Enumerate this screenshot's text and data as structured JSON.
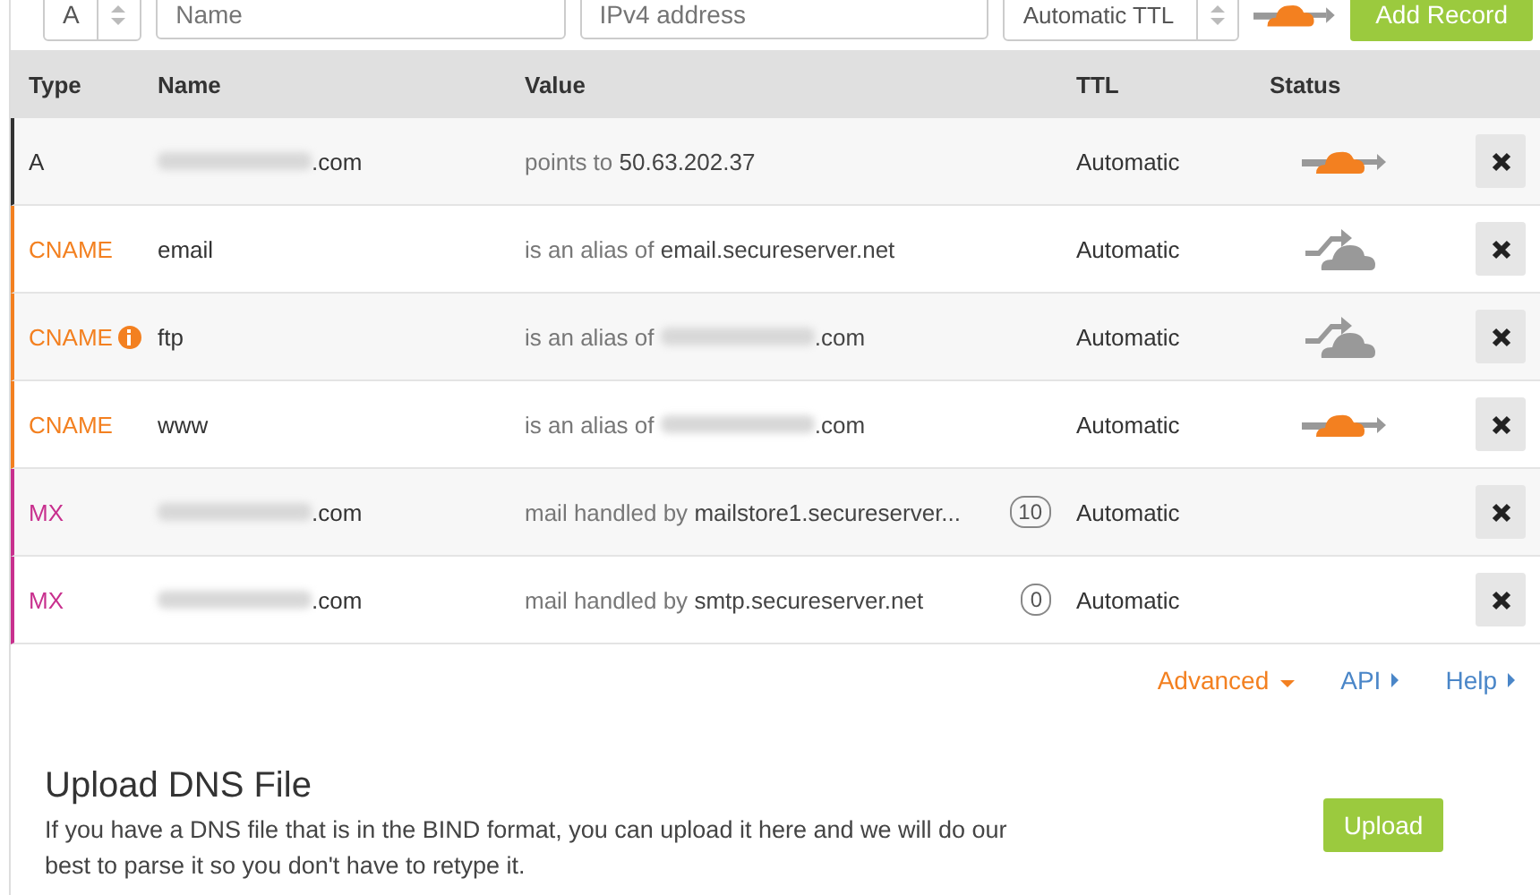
{
  "form": {
    "type_value": "A",
    "name_placeholder": "Name",
    "value_placeholder": "IPv4 address",
    "ttl_value": "Automatic TTL",
    "proxied": true,
    "add_button": "Add Record"
  },
  "table": {
    "columns": [
      "Type",
      "Name",
      "Value",
      "TTL",
      "Status"
    ],
    "rows": [
      {
        "type": "A",
        "color": "#333333",
        "info": false,
        "name": ".com",
        "name_redacted": true,
        "value_prefix": "points to",
        "value_target": "50.63.202.37",
        "value_redacted": false,
        "ttl": "Automatic",
        "kind": "proxied"
      },
      {
        "type": "CNAME",
        "color": "#f38020",
        "info": false,
        "name": "email",
        "name_redacted": false,
        "value_prefix": "is an alias of",
        "value_target": "email.secureserver.net",
        "value_redacted": false,
        "ttl": "Automatic",
        "kind": "dns_only"
      },
      {
        "type": "CNAME",
        "color": "#f38020",
        "info": true,
        "name": "ftp",
        "name_redacted": false,
        "value_prefix": "is an alias of",
        "value_target": ".com",
        "value_redacted": true,
        "ttl": "Automatic",
        "kind": "dns_only"
      },
      {
        "type": "CNAME",
        "color": "#f38020",
        "info": false,
        "name": "www",
        "name_redacted": false,
        "value_prefix": "is an alias of",
        "value_target": ".com",
        "value_redacted": true,
        "ttl": "Automatic",
        "kind": "proxied"
      },
      {
        "type": "MX",
        "color": "#c8308e",
        "info": false,
        "name": ".com",
        "name_redacted": true,
        "value_prefix": "mail handled by",
        "value_target": "mailstore1.secureserver...",
        "value_redacted": false,
        "priority": "10",
        "ttl": "Automatic",
        "kind": "none"
      },
      {
        "type": "MX",
        "color": "#c8308e",
        "info": false,
        "name": ".com",
        "name_redacted": true,
        "value_prefix": "mail handled by",
        "value_target": "smtp.secureserver.net",
        "value_redacted": false,
        "priority": "0",
        "ttl": "Automatic",
        "kind": "none"
      }
    ]
  },
  "links": [
    {
      "label": "Advanced",
      "kind": "dropdown"
    },
    {
      "label": "API",
      "kind": "link"
    },
    {
      "label": "Help",
      "kind": "link"
    }
  ],
  "upload": {
    "title": "Upload DNS File",
    "text": "If you have a DNS file that is in the BIND format, you can upload it here and we will do our best to parse it so you don't have to retype it.",
    "button": "Upload"
  }
}
